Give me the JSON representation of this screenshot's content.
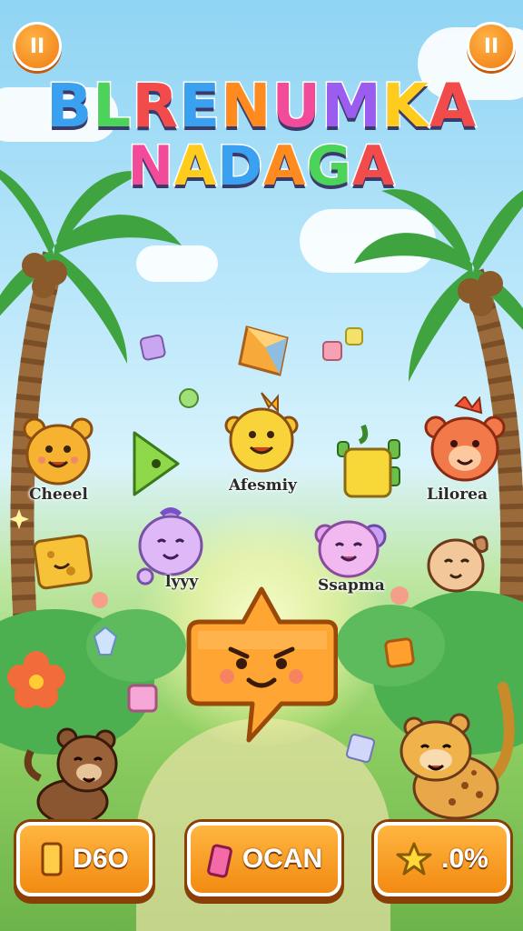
{
  "header": {
    "left_button_icon": "pause-icon",
    "left_button_label": "II",
    "right_button_icon": "pause-icon",
    "right_button_label": "II"
  },
  "title": {
    "line1": "BLRENUMKA",
    "line2": "NADAGA",
    "line1_colors": [
      "#3aa0f0",
      "#4cd35a",
      "#f24b4b",
      "#3aa0f0",
      "#ff8a1e",
      "#f24b9a",
      "#9b5cf0",
      "#ffcc1e",
      "#f24b4b"
    ],
    "line2_colors": [
      "#f24b9a",
      "#ffcc1e",
      "#3aa0f0",
      "#ff8a1e",
      "#4cd35a",
      "#f24b4b"
    ]
  },
  "characters": [
    {
      "name": "Cheeel",
      "icon": "yellow-bear-icon"
    },
    {
      "name": "Afesmiy",
      "icon": "yellow-sun-creature-icon"
    },
    {
      "name": "Lilorea",
      "icon": "red-bear-icon"
    },
    {
      "name": "lyyy",
      "icon": "purple-blob-icon"
    },
    {
      "name": "Ssapma",
      "icon": "pink-blob-icon"
    }
  ],
  "hero": {
    "icon": "orange-star-block-icon"
  },
  "bottom_buttons": [
    {
      "label": "D6O",
      "icon": "orange-card-icon"
    },
    {
      "label": "OCAN",
      "icon": "pink-candy-icon"
    },
    {
      "label": ".0%",
      "icon": "star-icon"
    }
  ],
  "colors": {
    "button_orange": "#f28a12",
    "button_border": "#8a3f07",
    "sky": "#8fd4f3",
    "grass": "#8fcf63"
  }
}
